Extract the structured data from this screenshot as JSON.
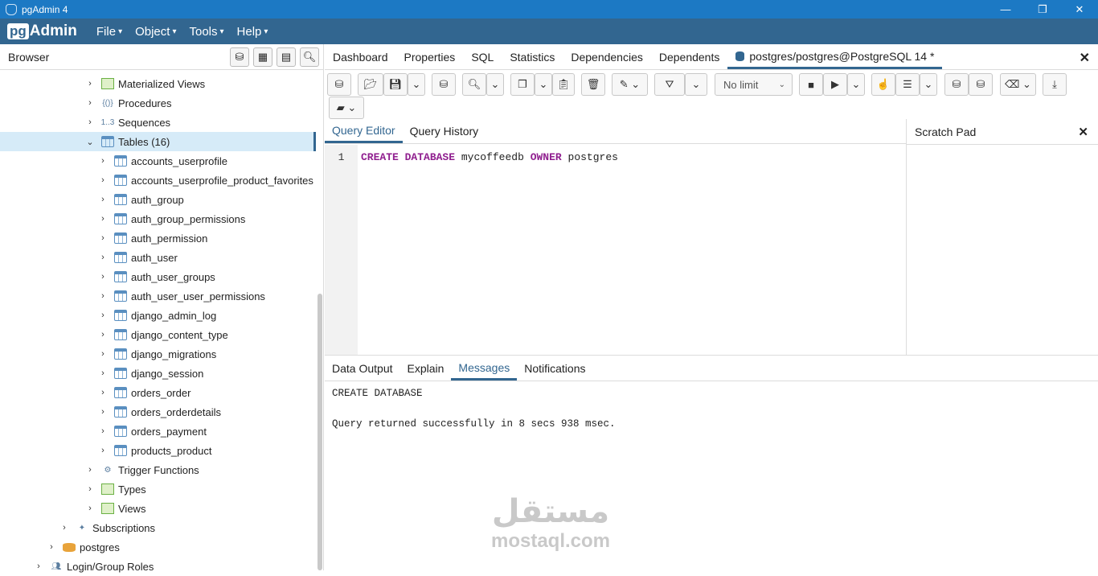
{
  "window": {
    "title": "pgAdmin 4",
    "minimize": "—",
    "restore": "❐",
    "close": "✕"
  },
  "menubar": {
    "logo_pg": "pg",
    "logo_admin": "Admin",
    "items": [
      {
        "label": "File",
        "caret": "▾"
      },
      {
        "label": "Object",
        "caret": "▾"
      },
      {
        "label": "Tools",
        "caret": "▾"
      },
      {
        "label": "Help",
        "caret": "▾"
      }
    ]
  },
  "browser": {
    "title": "Browser",
    "toolbar_icons": [
      "query-tool-icon",
      "view-data-icon",
      "filtered-rows-icon",
      "search-objects-icon"
    ],
    "tree": [
      {
        "label": "Materialized Views",
        "chev": "›",
        "icon": "materialized-views-icon"
      },
      {
        "label": "Procedures",
        "chev": "›",
        "icon": "procedures-icon",
        "glyph": "{()}"
      },
      {
        "label": "Sequences",
        "chev": "›",
        "icon": "sequences-icon",
        "glyph": "1..3"
      },
      {
        "label": "Tables (16)",
        "chev": "⌄",
        "icon": "tables-icon"
      },
      {
        "label": "accounts_userprofile",
        "chev": "›",
        "icon": "table-icon"
      },
      {
        "label": "accounts_userprofile_product_favorites",
        "chev": "›",
        "icon": "table-icon"
      },
      {
        "label": "auth_group",
        "chev": "›",
        "icon": "table-icon"
      },
      {
        "label": "auth_group_permissions",
        "chev": "›",
        "icon": "table-icon"
      },
      {
        "label": "auth_permission",
        "chev": "›",
        "icon": "table-icon"
      },
      {
        "label": "auth_user",
        "chev": "›",
        "icon": "table-icon"
      },
      {
        "label": "auth_user_groups",
        "chev": "›",
        "icon": "table-icon"
      },
      {
        "label": "auth_user_user_permissions",
        "chev": "›",
        "icon": "table-icon"
      },
      {
        "label": "django_admin_log",
        "chev": "›",
        "icon": "table-icon"
      },
      {
        "label": "django_content_type",
        "chev": "›",
        "icon": "table-icon"
      },
      {
        "label": "django_migrations",
        "chev": "›",
        "icon": "table-icon"
      },
      {
        "label": "django_session",
        "chev": "›",
        "icon": "table-icon"
      },
      {
        "label": "orders_order",
        "chev": "›",
        "icon": "table-icon"
      },
      {
        "label": "orders_orderdetails",
        "chev": "›",
        "icon": "table-icon"
      },
      {
        "label": "orders_payment",
        "chev": "›",
        "icon": "table-icon"
      },
      {
        "label": "products_product",
        "chev": "›",
        "icon": "table-icon"
      },
      {
        "label": "Trigger Functions",
        "chev": "›",
        "icon": "trigger-functions-icon"
      },
      {
        "label": "Types",
        "chev": "›",
        "icon": "types-icon"
      },
      {
        "label": "Views",
        "chev": "›",
        "icon": "views-icon"
      },
      {
        "label": "Subscriptions",
        "chev": "›",
        "icon": "subscriptions-icon"
      },
      {
        "label": "postgres",
        "chev": "›",
        "icon": "database-icon"
      },
      {
        "label": "Login/Group Roles",
        "chev": "›",
        "icon": "roles-icon"
      }
    ]
  },
  "tabs": {
    "items": [
      "Dashboard",
      "Properties",
      "SQL",
      "Statistics",
      "Dependencies",
      "Dependents"
    ],
    "active_query_tab": "postgres/postgres@PostgreSQL 14 *",
    "close": "✕"
  },
  "toolbar": {
    "limit_select": "No limit",
    "caret": "⌄"
  },
  "editor": {
    "tabs": [
      "Query Editor",
      "Query History"
    ],
    "line_number": "1",
    "code": {
      "kw1": "CREATE",
      "kw2": "DATABASE",
      "name": "mycoffeedb",
      "kw3": "OWNER",
      "owner": "postgres"
    },
    "scratch_title": "Scratch Pad",
    "scratch_close": "✕"
  },
  "output": {
    "tabs": [
      "Data Output",
      "Explain",
      "Messages",
      "Notifications"
    ],
    "messages": [
      "CREATE DATABASE",
      "Query returned successfully in 8 secs 938 msec."
    ]
  },
  "watermark": {
    "arabic": "مستقل",
    "latin": "mostaql.com"
  }
}
